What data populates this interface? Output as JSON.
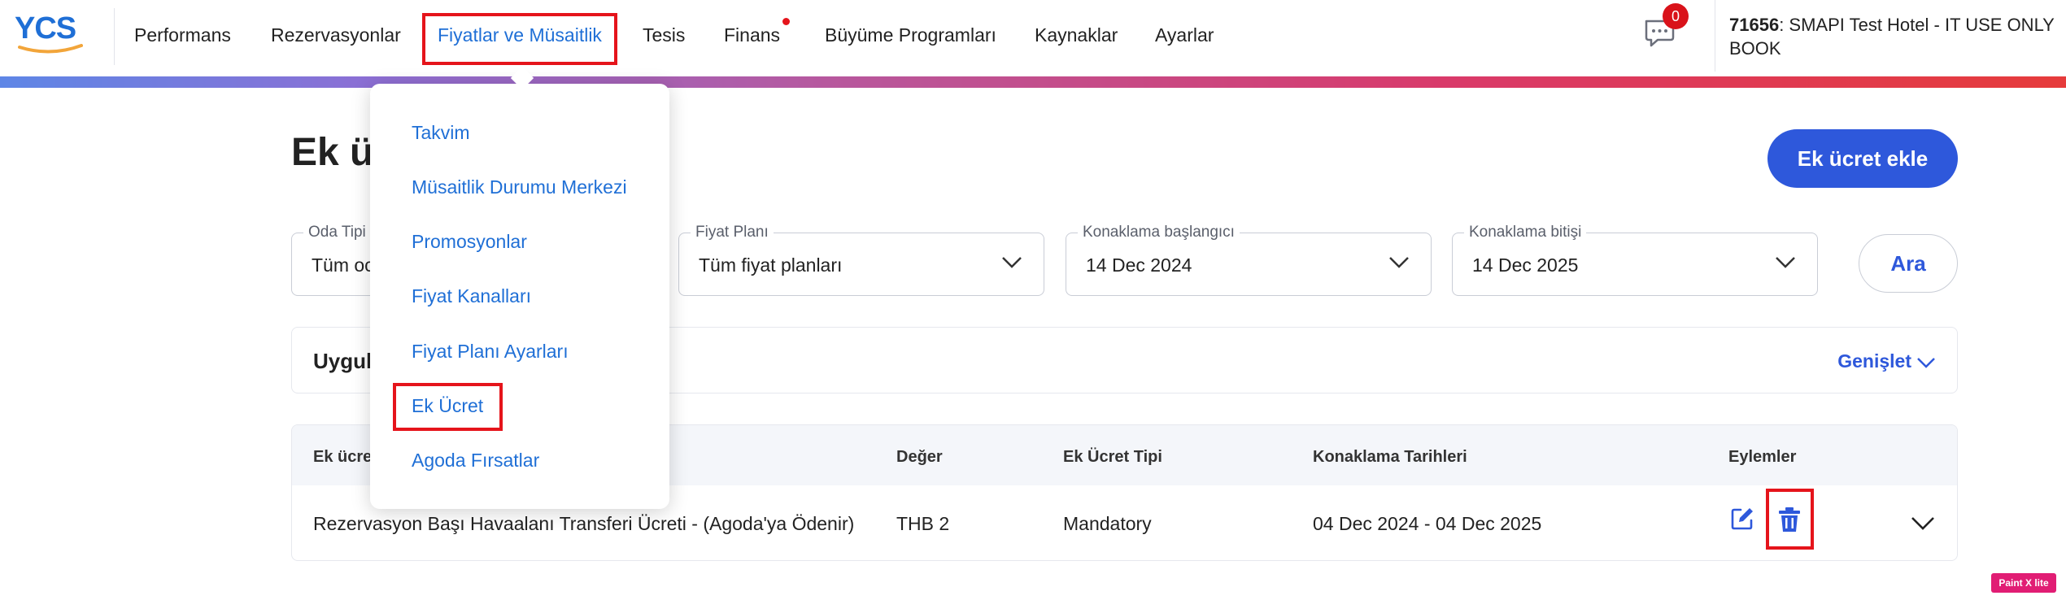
{
  "header": {
    "logo_text": "YCS",
    "nav": [
      {
        "label": "Performans"
      },
      {
        "label": "Rezervasyonlar"
      },
      {
        "label": "Fiyatlar ve Müsaitlik"
      },
      {
        "label": "Tesis"
      },
      {
        "label": "Finans"
      },
      {
        "label": "Büyüme Programları"
      },
      {
        "label": "Kaynaklar"
      },
      {
        "label": "Ayarlar"
      }
    ],
    "active_nav": "Fiyatlar ve Müsaitlik",
    "notification_count": "0",
    "hotel_id": "71656",
    "hotel_name": ": SMAPI Test Hotel - IT USE ONLY",
    "hotel_name_line2": "BOOK"
  },
  "dropdown": {
    "items": [
      {
        "label": "Takvim"
      },
      {
        "label": "Müsaitlik Durumu Merkezi"
      },
      {
        "label": "Promosyonlar"
      },
      {
        "label": "Fiyat Kanalları"
      },
      {
        "label": "Fiyat Planı Ayarları"
      },
      {
        "label": "Ek Ücret"
      },
      {
        "label": "Agoda Fırsatlar"
      }
    ],
    "highlighted": "Ek Ücret"
  },
  "page": {
    "title": "Ek üc",
    "add_button": "Ek ücret ekle"
  },
  "filters": {
    "room_type": {
      "label": "Oda Tipi",
      "value": "Tüm oc"
    },
    "rate_plan": {
      "label": "Fiyat Planı",
      "value": "Tüm fiyat planları"
    },
    "stay_start": {
      "label": "Konaklama başlangıcı",
      "value": "14 Dec 2024"
    },
    "stay_end": {
      "label": "Konaklama bitişi",
      "value": "14 Dec 2025"
    },
    "search_button": "Ara"
  },
  "applied": {
    "title": "Uygul",
    "expand_label": "Genişlet"
  },
  "table": {
    "columns": [
      "Ek ücre",
      "Değer",
      "Ek Ücret Tipi",
      "Konaklama Tarihleri",
      "Eylemler"
    ],
    "rows": [
      {
        "name": "Rezervasyon Başı Havaalanı Transferi Ücreti - (Agoda'ya Ödenir)",
        "value": "THB 2",
        "type": "Mandatory",
        "dates": "04 Dec 2024 - 04 Dec 2025"
      }
    ]
  },
  "watermark": "Paint X lite",
  "colors": {
    "brand_blue": "#1f6fd6",
    "button_blue": "#2e58db",
    "highlight_red": "#e5141b",
    "badge_red": "#d9121a"
  }
}
